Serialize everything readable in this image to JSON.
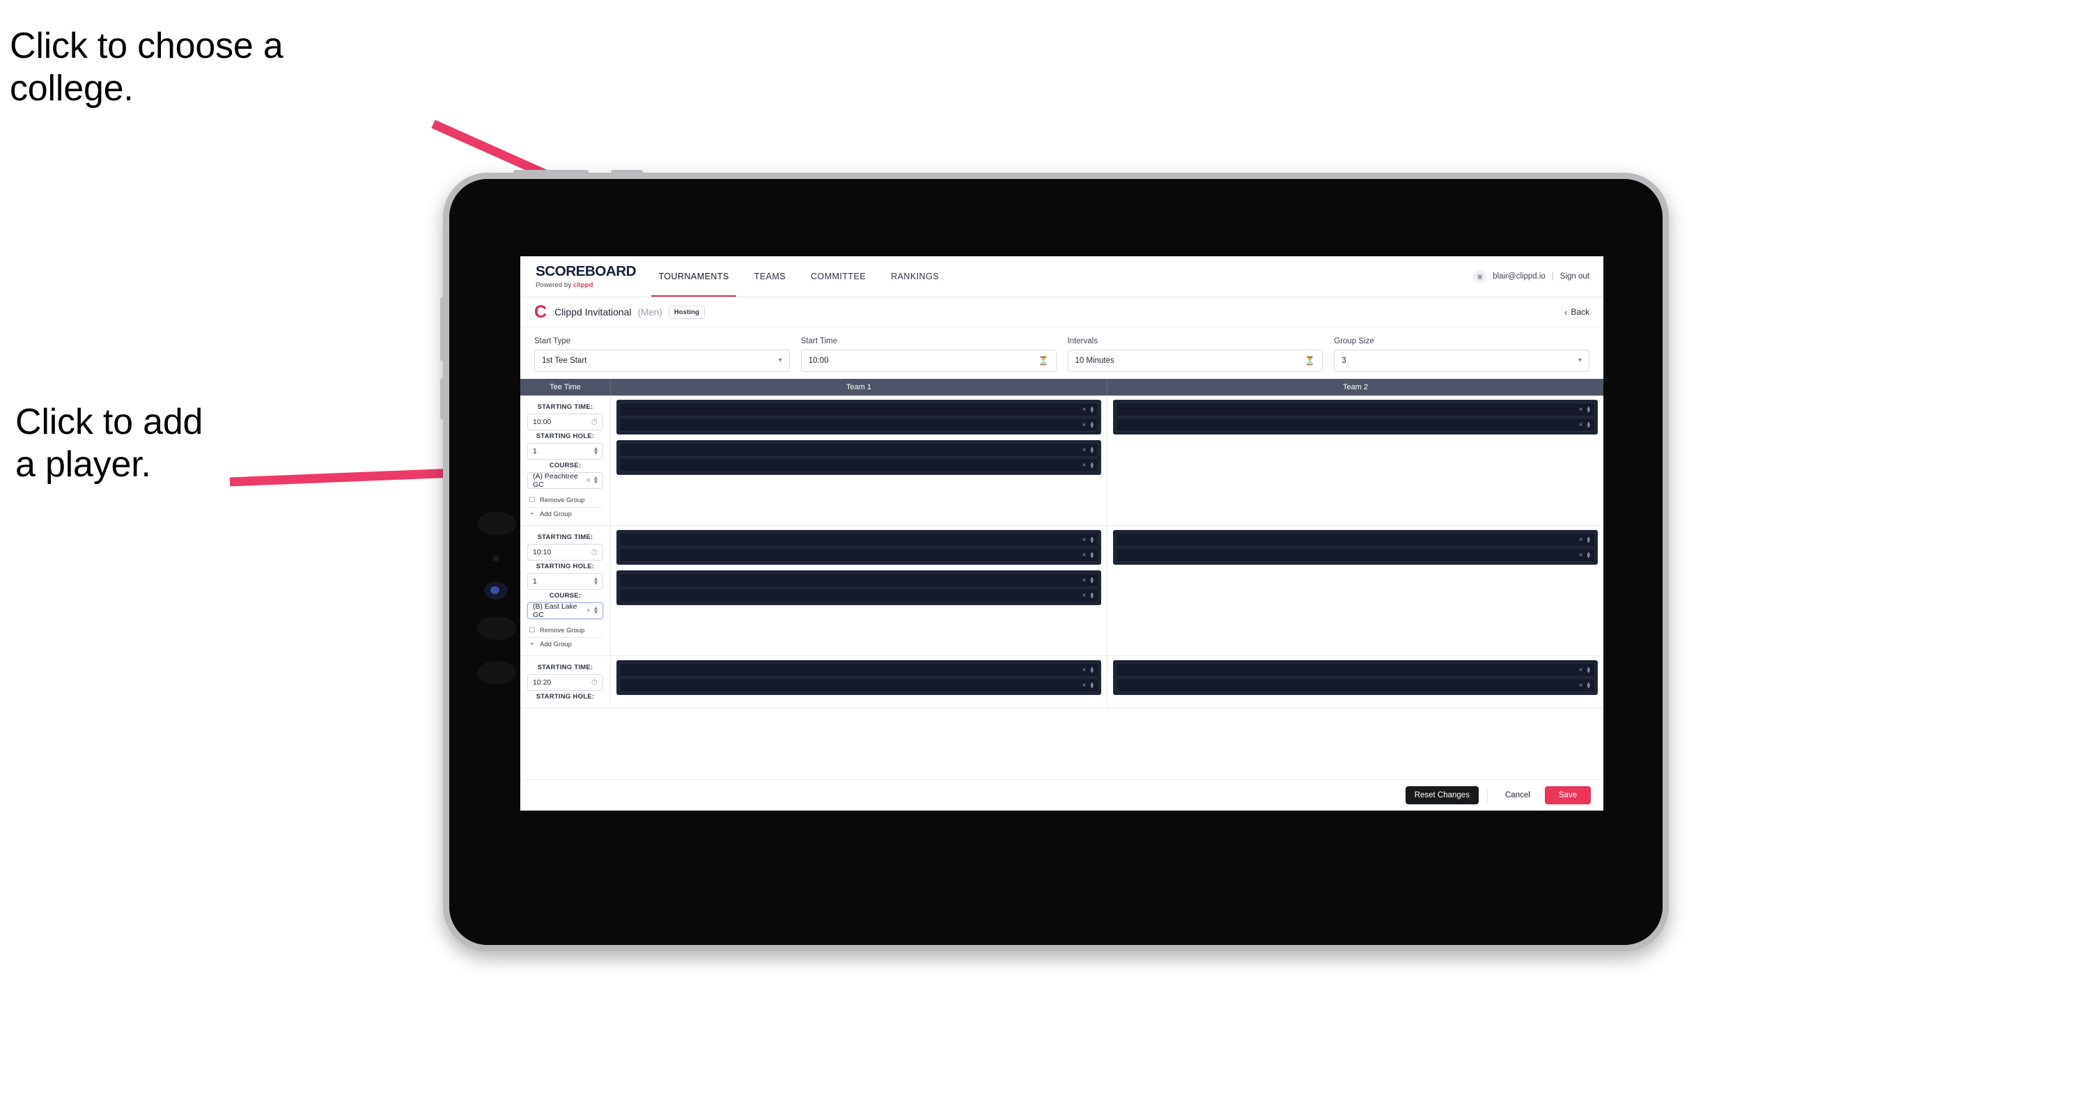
{
  "annotations": [
    {
      "id": "choose-college",
      "text": "Click to choose a\ncollege."
    },
    {
      "id": "add-player",
      "text": "Click to add\na player."
    }
  ],
  "app": {
    "navbar": {
      "brand": {
        "title": "SCOREBOARD",
        "powered_prefix": "Powered by ",
        "powered_brand": "clippd"
      },
      "tabs": [
        {
          "label": "TOURNAMENTS",
          "active": true
        },
        {
          "label": "TEAMS",
          "active": false
        },
        {
          "label": "COMMITTEE",
          "active": false
        },
        {
          "label": "RANKINGS",
          "active": false
        }
      ],
      "account": {
        "avatar_icon": "user-badge-icon",
        "email": "blair@clippd.io",
        "separator": "|",
        "sign_out": "Sign out"
      }
    },
    "subheader": {
      "logo": "C",
      "event_name": "Clippd Invitational",
      "event_gender": "(Men)",
      "role_badge": "Hosting",
      "back_label": "Back",
      "back_icon": "chevron-left-icon"
    },
    "controls": [
      {
        "label": "Start Type",
        "value": "1st Tee Start",
        "icon": "stepper-icon"
      },
      {
        "label": "Start Time",
        "value": "10:00",
        "icon": "clock-icon"
      },
      {
        "label": "Intervals",
        "value": "10 Minutes",
        "icon": "clock-icon"
      },
      {
        "label": "Group Size",
        "value": "3",
        "icon": "stepper-icon"
      }
    ],
    "table": {
      "headers": {
        "tee_time": "Tee Time",
        "team1": "Team 1",
        "team2": "Team 2"
      },
      "field_labels": {
        "starting_time": "STARTING TIME:",
        "starting_hole": "STARTING HOLE:",
        "course": "COURSE:"
      },
      "group_actions": {
        "remove": "Remove Group",
        "add": "Add Group",
        "remove_icon": "trash-icon",
        "add_icon": "plus-icon"
      },
      "rows": [
        {
          "starting_time": "10:00",
          "starting_hole": "1",
          "course": "(A) Peachtree GC",
          "course_focused": false,
          "team1_groups": [
            {
              "slots": [
                {
                  "value": ""
                },
                {
                  "value": ""
                }
              ]
            },
            {
              "slots": [
                {
                  "value": ""
                },
                {
                  "value": ""
                }
              ]
            }
          ],
          "team2_groups": [
            {
              "slots": [
                {
                  "value": ""
                },
                {
                  "value": ""
                }
              ]
            }
          ]
        },
        {
          "starting_time": "10:10",
          "starting_hole": "1",
          "course": "(B) East Lake GC",
          "course_focused": true,
          "team1_groups": [
            {
              "slots": [
                {
                  "value": ""
                },
                {
                  "value": ""
                }
              ]
            },
            {
              "slots": [
                {
                  "value": ""
                },
                {
                  "value": ""
                }
              ]
            }
          ],
          "team2_groups": [
            {
              "slots": [
                {
                  "value": ""
                },
                {
                  "value": ""
                }
              ]
            }
          ]
        },
        {
          "starting_time": "10:20",
          "starting_hole": "",
          "course": "",
          "course_focused": false,
          "partial": true,
          "team1_groups": [
            {
              "slots": [
                {
                  "value": ""
                },
                {
                  "value": ""
                }
              ]
            }
          ],
          "team2_groups": [
            {
              "slots": [
                {
                  "value": ""
                },
                {
                  "value": ""
                }
              ]
            }
          ]
        }
      ]
    },
    "footer": {
      "reset_label": "Reset Changes",
      "cancel_label": "Cancel",
      "save_label": "Save"
    }
  },
  "colors": {
    "accent_pink": "#ea3659",
    "annotation_arrow": "#ec3a68",
    "table_header": "#4e5568",
    "slot_dark": "#141a29",
    "group_dark": "#1b2233",
    "brand_red": "#d92b4b"
  }
}
